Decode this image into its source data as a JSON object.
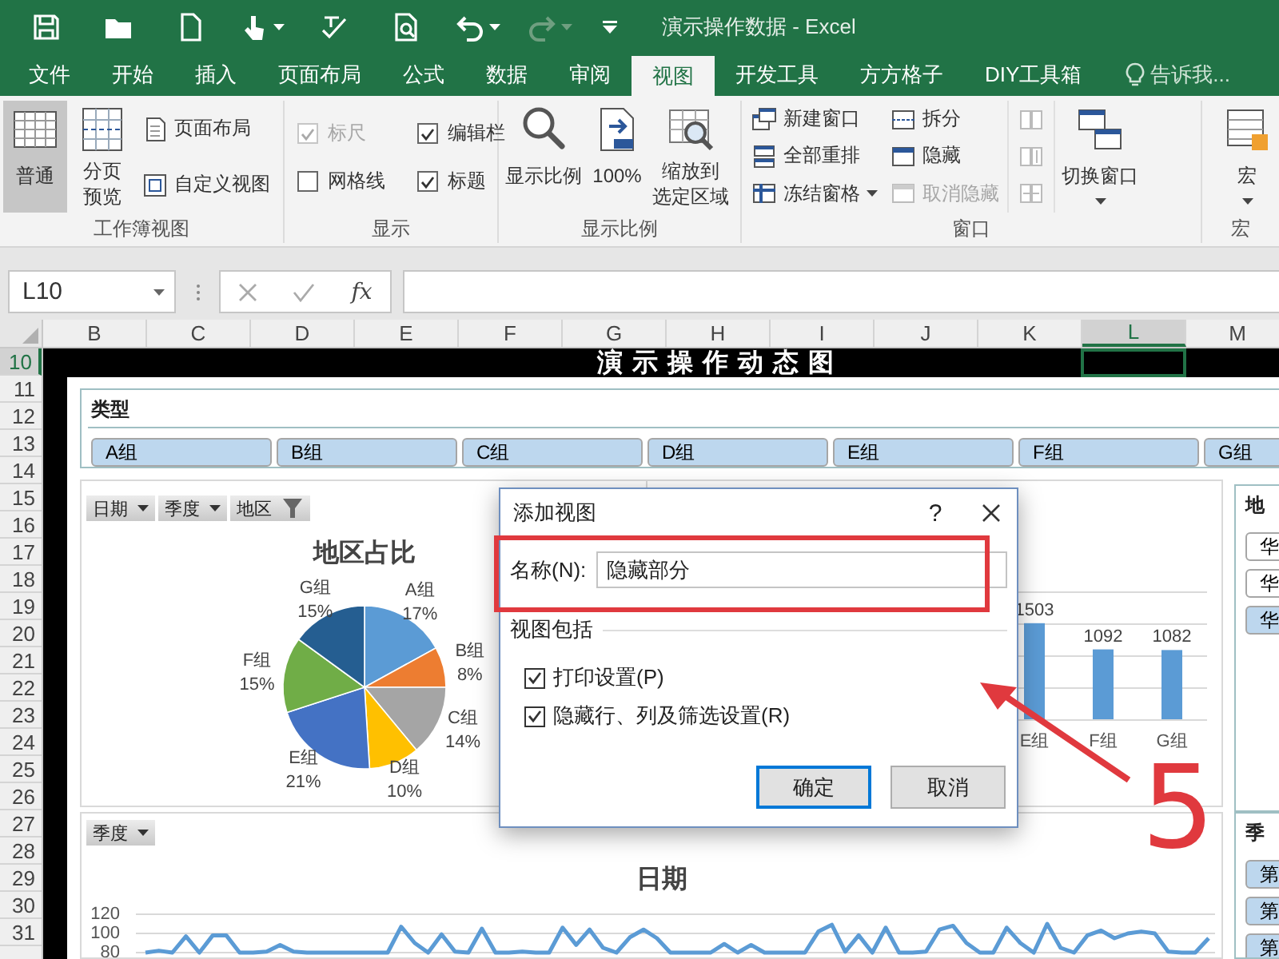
{
  "title_bar": {
    "title": "演示操作数据 - Excel"
  },
  "tabs": [
    {
      "label": "文件",
      "selected": false
    },
    {
      "label": "开始",
      "selected": false
    },
    {
      "label": "插入",
      "selected": false
    },
    {
      "label": "页面布局",
      "selected": false
    },
    {
      "label": "公式",
      "selected": false
    },
    {
      "label": "数据",
      "selected": false
    },
    {
      "label": "审阅",
      "selected": false
    },
    {
      "label": "视图",
      "selected": true
    },
    {
      "label": "开发工具",
      "selected": false
    },
    {
      "label": "方方格子",
      "selected": false
    },
    {
      "label": "DIY工具箱",
      "selected": false
    }
  ],
  "tell_me": {
    "placeholder": "告诉我..."
  },
  "ribbon_groups": [
    {
      "title": "工作簿视图",
      "columns": [
        {
          "kind": "large",
          "lines": [
            "普通"
          ],
          "selected": true
        },
        {
          "kind": "large",
          "lines": [
            "分页",
            "预览"
          ],
          "selected": false
        },
        {
          "kind": "stack",
          "items": [
            {
              "label": "页面布局",
              "disabled": false,
              "dropdown": false
            },
            {
              "label": "自定义视图",
              "disabled": false,
              "dropdown": false
            }
          ]
        }
      ]
    },
    {
      "title": "显示",
      "columns": [
        {
          "kind": "checks",
          "items": [
            {
              "label": "标尺",
              "checked": true,
              "disabled": true
            },
            {
              "label": "网格线",
              "checked": false,
              "disabled": false
            }
          ]
        },
        {
          "kind": "checks",
          "items": [
            {
              "label": "编辑栏",
              "checked": true,
              "disabled": false
            },
            {
              "label": "标题",
              "checked": true,
              "disabled": false
            }
          ]
        }
      ]
    },
    {
      "title": "显示比例",
      "columns": [
        {
          "kind": "large",
          "lines": [
            "显示比例"
          ]
        },
        {
          "kind": "large",
          "lines": [
            "100%"
          ]
        },
        {
          "kind": "large",
          "lines": [
            "缩放到",
            "选定区域"
          ]
        }
      ]
    },
    {
      "title": "窗口",
      "columns": [
        {
          "kind": "stack",
          "items": [
            {
              "label": "新建窗口",
              "disabled": false,
              "dropdown": false
            },
            {
              "label": "全部重排",
              "disabled": false,
              "dropdown": false
            },
            {
              "label": "冻结窗格",
              "disabled": false,
              "dropdown": true
            }
          ]
        },
        {
          "kind": "stack",
          "items": [
            {
              "label": "拆分",
              "disabled": false,
              "dropdown": false
            },
            {
              "label": "隐藏",
              "disabled": false,
              "dropdown": false
            },
            {
              "label": "取消隐藏",
              "disabled": true,
              "dropdown": false
            }
          ]
        },
        {
          "kind": "icon_stack",
          "disabled": true
        },
        {
          "kind": "large",
          "lines": [
            "切换窗口"
          ],
          "dropdown": true
        }
      ]
    },
    {
      "title": "宏",
      "columns": [
        {
          "kind": "large",
          "lines": [
            "宏"
          ],
          "dropdown": true
        }
      ]
    }
  ],
  "formula_bar": {
    "name_box": "L10",
    "function_button": "fx"
  },
  "columns": [
    {
      "label": "B",
      "selected": false
    },
    {
      "label": "C",
      "selected": false
    },
    {
      "label": "D",
      "selected": false
    },
    {
      "label": "E",
      "selected": false
    },
    {
      "label": "F",
      "selected": false
    },
    {
      "label": "G",
      "selected": false
    },
    {
      "label": "H",
      "selected": false
    },
    {
      "label": "I",
      "selected": false
    },
    {
      "label": "J",
      "selected": false
    },
    {
      "label": "K",
      "selected": false
    },
    {
      "label": "L",
      "selected": true
    },
    {
      "label": "M",
      "selected": false
    }
  ],
  "rows": [
    {
      "label": "10",
      "selected": true
    },
    {
      "label": "11",
      "selected": false
    },
    {
      "label": "12",
      "selected": false
    },
    {
      "label": "13",
      "selected": false
    },
    {
      "label": "14",
      "selected": false
    },
    {
      "label": "15",
      "selected": false
    },
    {
      "label": "16",
      "selected": false
    },
    {
      "label": "17",
      "selected": false
    },
    {
      "label": "18",
      "selected": false
    },
    {
      "label": "19",
      "selected": false
    },
    {
      "label": "20",
      "selected": false
    },
    {
      "label": "21",
      "selected": false
    },
    {
      "label": "22",
      "selected": false
    },
    {
      "label": "23",
      "selected": false
    },
    {
      "label": "24",
      "selected": false
    },
    {
      "label": "25",
      "selected": false
    },
    {
      "label": "26",
      "selected": false
    },
    {
      "label": "27",
      "selected": false
    },
    {
      "label": "28",
      "selected": false
    },
    {
      "label": "29",
      "selected": false
    },
    {
      "label": "30",
      "selected": false
    },
    {
      "label": "31",
      "selected": false
    }
  ],
  "sheet_title": "演示操作动态图",
  "type_slicer": {
    "title": "类型",
    "items": [
      {
        "label": "A组",
        "selected": true
      },
      {
        "label": "B组",
        "selected": true
      },
      {
        "label": "C组",
        "selected": true
      },
      {
        "label": "D组",
        "selected": true
      },
      {
        "label": "E组",
        "selected": true
      },
      {
        "label": "F组",
        "selected": true
      },
      {
        "label": "G组",
        "selected": true
      }
    ]
  },
  "pie_panel": {
    "filters": [
      {
        "label": "日期",
        "filtered": false
      },
      {
        "label": "季度",
        "filtered": false
      },
      {
        "label": "地区",
        "filtered": true
      }
    ],
    "chart_data": {
      "type": "pie",
      "title": "地区占比",
      "categories": [
        "A组",
        "B组",
        "C组",
        "D组",
        "E组",
        "F组",
        "G组"
      ],
      "series": [
        {
          "values": [
            17,
            8,
            14,
            10,
            21,
            15,
            15
          ]
        }
      ],
      "value_labels": [
        "17%",
        "8%",
        "14%",
        "10%",
        "21%",
        "15%",
        "15%"
      ]
    }
  },
  "bar_panel": {
    "chart_data": {
      "type": "bar",
      "categories": [
        "E组",
        "F组",
        "G组"
      ],
      "values": [
        1503,
        1092,
        1082
      ],
      "value_labels": [
        "1503",
        "1092",
        "1082"
      ]
    }
  },
  "region_slicer": {
    "title": "地",
    "items": [
      {
        "label": "华",
        "selected": false
      },
      {
        "label": "华",
        "selected": false
      },
      {
        "label": "华",
        "selected": true
      }
    ]
  },
  "line_panel": {
    "filters": [
      {
        "label": "季度",
        "filtered": false
      }
    ],
    "chart_data": {
      "type": "line",
      "title": "日期",
      "yticks": [
        80,
        100,
        120
      ],
      "ylim": [
        80,
        120
      ],
      "series": [
        {
          "values": [
            80,
            82,
            80,
            97,
            80,
            98,
            98,
            80,
            80,
            81,
            88,
            81,
            80,
            80,
            80,
            80,
            80,
            80,
            80,
            107,
            90,
            80,
            99,
            81,
            80,
            105,
            80,
            80,
            81,
            80,
            80,
            106,
            88,
            104,
            85,
            80,
            96,
            104,
            95,
            80,
            80,
            80,
            80,
            89,
            80,
            88,
            80,
            80,
            80,
            80,
            102,
            109,
            81,
            98,
            80,
            106,
            80,
            80,
            81,
            104,
            108,
            90,
            80,
            80,
            106,
            90,
            80,
            110,
            85,
            80,
            98,
            103,
            95,
            100,
            102,
            100,
            81,
            80,
            80,
            95
          ]
        }
      ]
    }
  },
  "quarter_slicer": {
    "title": "季",
    "items": [
      {
        "label": "第",
        "selected": true
      },
      {
        "label": "第",
        "selected": true
      },
      {
        "label": "第",
        "selected": true
      }
    ]
  },
  "dialog": {
    "title": "添加视图",
    "help": "?",
    "name_label": "名称(N):",
    "name_value": "隐藏部分",
    "section": "视图包括",
    "options": [
      {
        "label": "打印设置(P)",
        "checked": true
      },
      {
        "label": "隐藏行、列及筛选设置(R)",
        "checked": true
      }
    ],
    "buttons": [
      {
        "label": "确定",
        "default": true
      },
      {
        "label": "取消",
        "default": false
      }
    ]
  },
  "annotations": [
    {
      "kind": "box"
    },
    {
      "kind": "arrow"
    },
    {
      "kind": "note",
      "text": "5"
    }
  ]
}
